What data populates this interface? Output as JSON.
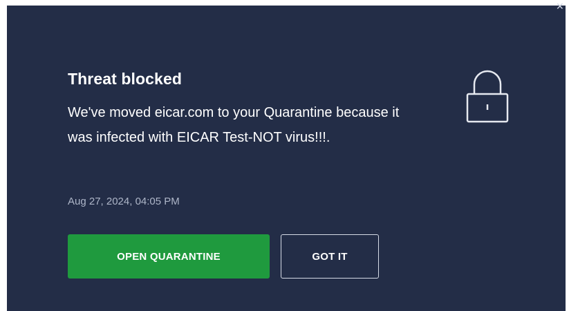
{
  "notification": {
    "title": "Threat blocked",
    "message": "We've moved eicar.com to your Quarantine because it was infected with EICAR Test-NOT virus!!!.",
    "timestamp": "Aug 27, 2024, 04:05 PM",
    "buttons": {
      "open_quarantine": "OPEN QUARANTINE",
      "got_it": "GOT IT"
    },
    "icons": {
      "status": "lock-icon",
      "close": "close-icon"
    },
    "colors": {
      "background": "#232d47",
      "primary_button": "#1f9a3e",
      "text": "#ffffff",
      "muted_text": "#aeb6c8"
    }
  }
}
